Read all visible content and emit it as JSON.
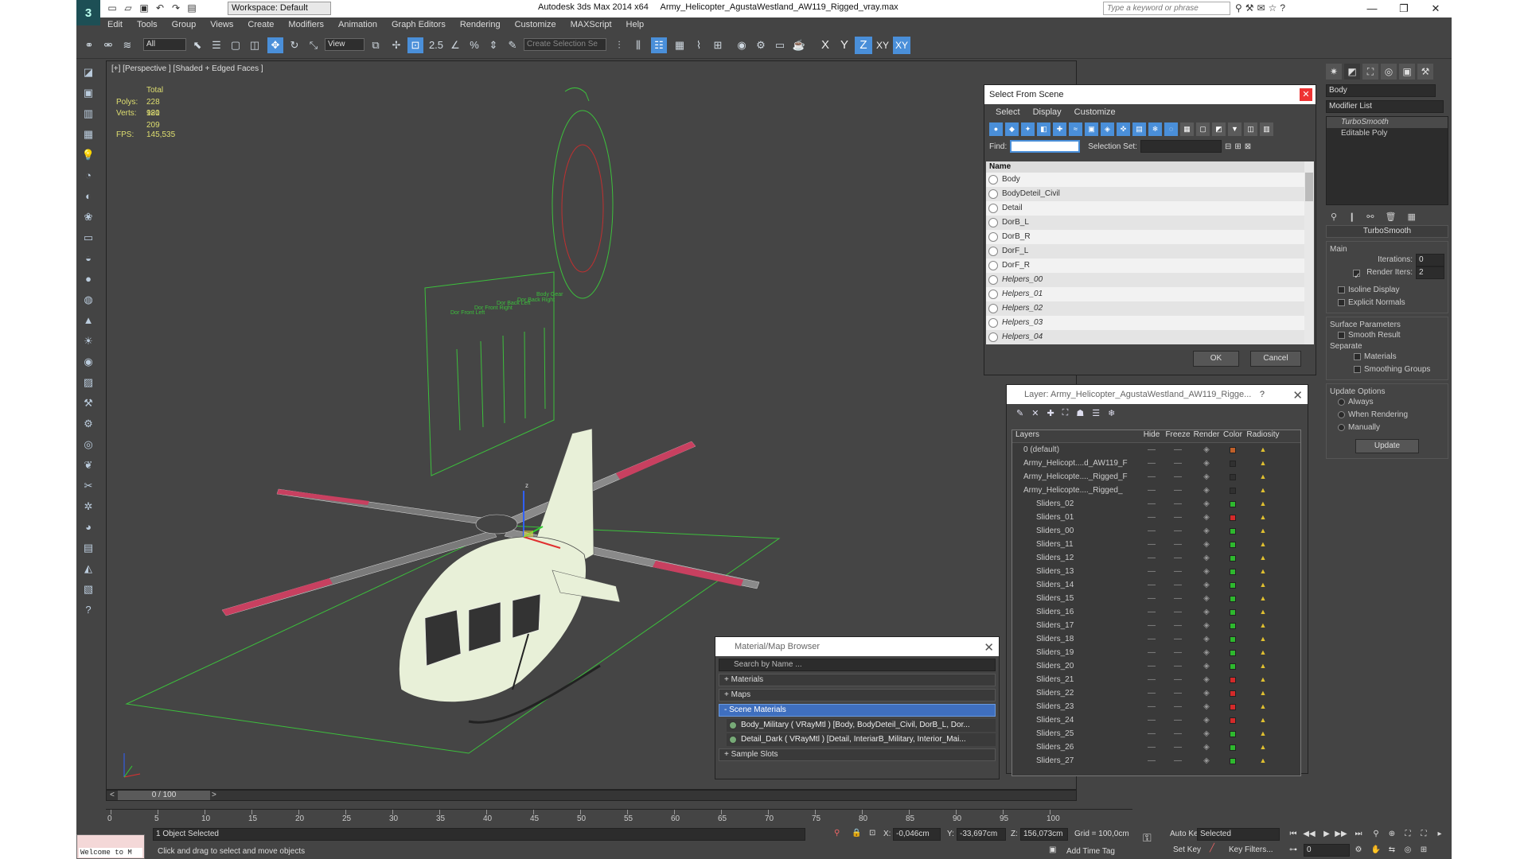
{
  "title_bar": {
    "app_title": "Autodesk 3ds Max  2014 x64",
    "file_name": "Army_Helicopter_AgustaWestland_AW119_Rigged_vray.max",
    "workspace": "Workspace: Default",
    "search_placeholder": "Type a keyword or phrase"
  },
  "menu": [
    "Edit",
    "Tools",
    "Group",
    "Views",
    "Create",
    "Modifiers",
    "Animation",
    "Graph Editors",
    "Rendering",
    "Customize",
    "MAXScript",
    "Help"
  ],
  "toolbar": {
    "filter_value": "All",
    "refcoord_value": "View",
    "selection_set_placeholder": "Create Selection Se",
    "snap_label": "2.5",
    "axes": [
      "X",
      "Y",
      "Z",
      "XY",
      "XY"
    ],
    "active_axis": "Z"
  },
  "viewport": {
    "label": "[+] [Perspective ] [Shaded + Edged Faces ]",
    "stats": {
      "total_label": "Total",
      "polys_label": "Polys:",
      "polys_value": "228 980",
      "verts_label": "Verts:",
      "verts_value": "121 209",
      "fps_label": "FPS:",
      "fps_value": "145,535"
    },
    "slider_labels": [
      "Dor Front Left",
      "Dor Front Right",
      "Dor Back Left",
      "Dor Back Right",
      "Body Gear"
    ]
  },
  "command_panel": {
    "object_name": "Body",
    "modifier_list": "Modifier List",
    "stack": [
      {
        "name": "TurboSmooth",
        "active": true
      },
      {
        "name": "Editable Poly",
        "active": false
      }
    ],
    "turbosmooth_header": "TurboSmooth",
    "main_label": "Main",
    "iterations_label": "Iterations:",
    "iterations_value": "0",
    "render_iters_label": "Render Iters:",
    "render_iters_value": "2",
    "isoline_label": "Isoline Display",
    "explicit_normals_label": "Explicit Normals",
    "surface_params_label": "Surface Parameters",
    "smooth_result_label": "Smooth Result",
    "separate_label": "Separate",
    "materials_label": "Materials",
    "smoothing_groups_label": "Smoothing Groups",
    "update_options_label": "Update Options",
    "always_label": "Always",
    "when_rendering_label": "When Rendering",
    "manually_label": "Manually",
    "update_button": "Update"
  },
  "select_dialog": {
    "title": "Select From Scene",
    "menu": [
      "Select",
      "Display",
      "Customize"
    ],
    "find_label": "Find:",
    "selection_set_label": "Selection Set:",
    "name_header": "Name",
    "items": [
      {
        "name": "Body",
        "italic": false
      },
      {
        "name": "BodyDeteil_Civil",
        "italic": false
      },
      {
        "name": "Detail",
        "italic": false
      },
      {
        "name": "DorB_L",
        "italic": false
      },
      {
        "name": "DorB_R",
        "italic": false
      },
      {
        "name": "DorF_L",
        "italic": false
      },
      {
        "name": "DorF_R",
        "italic": false
      },
      {
        "name": "Helpers_00",
        "italic": true
      },
      {
        "name": "Helpers_01",
        "italic": true
      },
      {
        "name": "Helpers_02",
        "italic": true
      },
      {
        "name": "Helpers_03",
        "italic": true
      },
      {
        "name": "Helpers_04",
        "italic": true
      }
    ],
    "ok_button": "OK",
    "cancel_button": "Cancel"
  },
  "layer_dialog": {
    "title": "Layer: Army_Helicopter_AgustaWestland_AW119_Rigge...",
    "help": "?",
    "columns": [
      "Layers",
      "Hide",
      "Freeze",
      "Render",
      "Color",
      "Radiosity"
    ],
    "rows": [
      {
        "name": "0 (default)",
        "color": "#c0602a",
        "indent": 1
      },
      {
        "name": "Army_Helicopt....d_AW119_F",
        "color": "#303030",
        "indent": 1
      },
      {
        "name": "Army_Helicopte...._Rigged_F",
        "color": "#303030",
        "indent": 1
      },
      {
        "name": "Army_Helicopte...._Rigged_",
        "color": "#303030",
        "indent": 1
      },
      {
        "name": "Sliders_02",
        "color": "#2eb82e",
        "indent": 2
      },
      {
        "name": "Sliders_01",
        "color": "#d42a2a",
        "indent": 2
      },
      {
        "name": "Sliders_00",
        "color": "#2eb82e",
        "indent": 2
      },
      {
        "name": "Sliders_11",
        "color": "#2eb82e",
        "indent": 2
      },
      {
        "name": "Sliders_12",
        "color": "#2eb82e",
        "indent": 2
      },
      {
        "name": "Sliders_13",
        "color": "#2eb82e",
        "indent": 2
      },
      {
        "name": "Sliders_14",
        "color": "#2eb82e",
        "indent": 2
      },
      {
        "name": "Sliders_15",
        "color": "#2eb82e",
        "indent": 2
      },
      {
        "name": "Sliders_16",
        "color": "#2eb82e",
        "indent": 2
      },
      {
        "name": "Sliders_17",
        "color": "#2eb82e",
        "indent": 2
      },
      {
        "name": "Sliders_18",
        "color": "#2eb82e",
        "indent": 2
      },
      {
        "name": "Sliders_19",
        "color": "#2eb82e",
        "indent": 2
      },
      {
        "name": "Sliders_20",
        "color": "#2eb82e",
        "indent": 2
      },
      {
        "name": "Sliders_21",
        "color": "#d42a2a",
        "indent": 2
      },
      {
        "name": "Sliders_22",
        "color": "#d42a2a",
        "indent": 2
      },
      {
        "name": "Sliders_23",
        "color": "#d42a2a",
        "indent": 2
      },
      {
        "name": "Sliders_24",
        "color": "#d42a2a",
        "indent": 2
      },
      {
        "name": "Sliders_25",
        "color": "#2eb82e",
        "indent": 2
      },
      {
        "name": "Sliders_26",
        "color": "#2eb82e",
        "indent": 2
      },
      {
        "name": "Sliders_27",
        "color": "#2eb82e",
        "indent": 2
      }
    ]
  },
  "material_browser": {
    "title": "Material/Map Browser",
    "search_placeholder": "Search by Name ...",
    "sections": [
      {
        "label": "+ Materials",
        "active": false
      },
      {
        "label": "+ Maps",
        "active": false
      },
      {
        "label": "- Scene Materials",
        "active": true
      }
    ],
    "items": [
      "Body_Military  ( VRayMtl ) [Body, BodyDeteil_Civil, DorB_L, Dor...",
      "Detail_Dark  ( VRayMtl ) [Detail, InteriarB_Military, Interior_Mai..."
    ],
    "sample_slots": "+ Sample Slots"
  },
  "timeline": {
    "frame_label": "0 / 100",
    "ticks": [
      "0",
      "5",
      "10",
      "15",
      "20",
      "25",
      "30",
      "35",
      "40",
      "45",
      "50",
      "55",
      "60",
      "65",
      "70",
      "75",
      "80",
      "85",
      "90",
      "95",
      "100"
    ]
  },
  "status": {
    "maxscript": "Welcome to M",
    "selected": "1 Object Selected",
    "prompt": "Click and drag to select and move objects",
    "x_label": "X:",
    "x_value": "-0,046cm",
    "y_label": "Y:",
    "y_value": "-33,697cm",
    "z_label": "Z:",
    "z_value": "156,073cm",
    "grid": "Grid = 100,0cm",
    "add_time_tag": "Add Time Tag",
    "auto_key": "Auto Key",
    "set_key": "Set Key",
    "key_mode": "Selected",
    "key_filters": "Key Filters...",
    "frame_value": "0"
  }
}
